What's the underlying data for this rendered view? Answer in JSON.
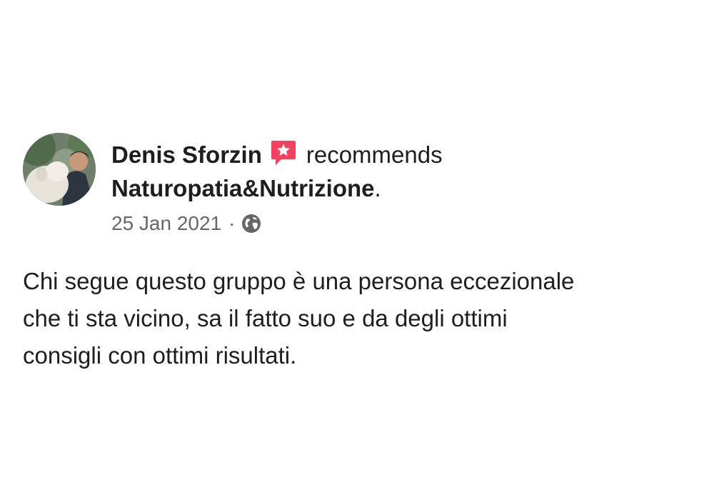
{
  "post": {
    "author": "Denis Sforzin",
    "verb": "recommends",
    "page_name": "Naturopatia&Nutrizione",
    "page_suffix": ".",
    "date": "25 Jan 2021",
    "separator": "·",
    "body": "Chi segue questo gruppo è una persona eccezionale\nche ti sta vicino, sa il fatto suo e da degli ottimi\nconsigli con ottimi risultati."
  },
  "icons": {
    "badge": "recommendation-star-icon",
    "privacy": "globe-icon"
  },
  "colors": {
    "badge": "#f3425f",
    "meta_text": "#65676b",
    "text": "#1c1e21"
  }
}
